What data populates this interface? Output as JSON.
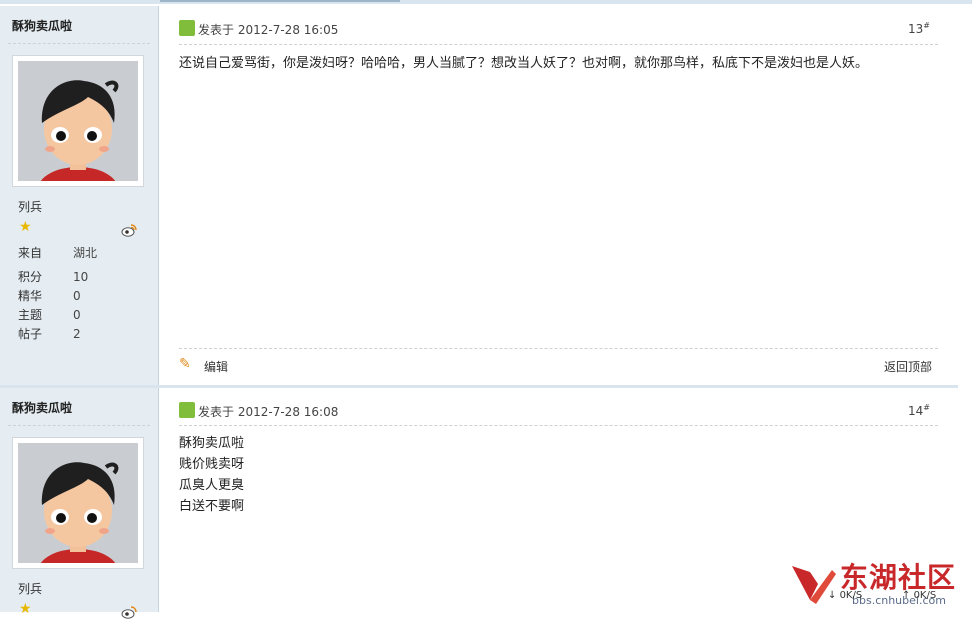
{
  "posts": [
    {
      "author": "酥狗卖瓜啦",
      "rank": "列兵",
      "info": [
        {
          "key": "来自",
          "value": "湖北"
        },
        {
          "key": "积分",
          "value": "10"
        },
        {
          "key": "精华",
          "value": "0"
        },
        {
          "key": "主题",
          "value": "0"
        },
        {
          "key": "帖子",
          "value": "2"
        }
      ],
      "posted_label": "发表于",
      "posted_time": "2012-7-28 16:05",
      "floor": "13",
      "floor_sup": "#",
      "content_lines": [
        "还说自己爱骂街，你是泼妇呀？哈哈哈，男人当腻了？想改当人妖了？也对啊，就你那鸟样，私底下不是泼妇也是人妖。"
      ],
      "edit_label": "编辑",
      "back_top_label": "返回顶部"
    },
    {
      "author": "酥狗卖瓜啦",
      "rank": "列兵",
      "posted_label": "发表于",
      "posted_time": "2012-7-28 16:08",
      "floor": "14",
      "floor_sup": "#",
      "content_lines": [
        "酥狗卖瓜啦",
        "贱价贱卖呀",
        "瓜臭人更臭",
        "白送不要啊"
      ]
    }
  ],
  "watermark": {
    "text": "东湖社区",
    "url": "bbs.cnhubei.com",
    "speed_down": "0K/S",
    "speed_up": "0K/S"
  },
  "colors": {
    "sidebar_bg": "#e5edf2",
    "watermark_red": "#c8282a",
    "icon_green": "#7fbd3a"
  }
}
